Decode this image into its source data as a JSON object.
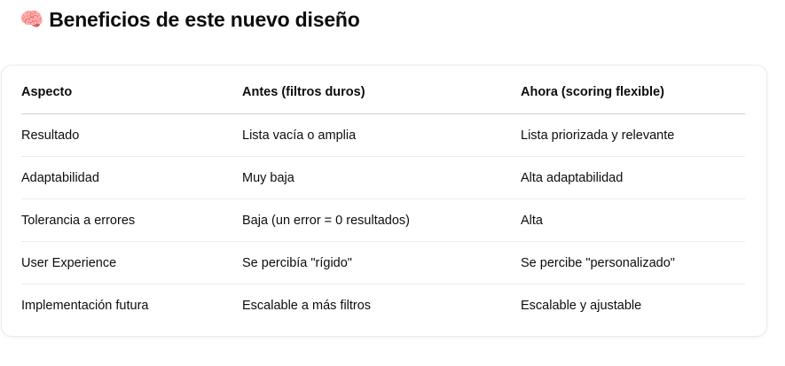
{
  "heading": {
    "emoji": "🧠",
    "title": "Beneficios de este nuevo diseño"
  },
  "table": {
    "headers": [
      "Aspecto",
      "Antes (filtros duros)",
      "Ahora (scoring flexible)"
    ],
    "rows": [
      [
        "Resultado",
        "Lista vacía o amplia",
        "Lista priorizada y relevante"
      ],
      [
        "Adaptabilidad",
        "Muy baja",
        "Alta adaptabilidad"
      ],
      [
        "Tolerancia a errores",
        "Baja (un error = 0 resultados)",
        "Alta"
      ],
      [
        "User Experience",
        "Se percibía \"rígido\"",
        "Se percibe \"personalizado\""
      ],
      [
        "Implementación futura",
        "Escalable a más filtros",
        "Escalable y ajustable"
      ]
    ]
  }
}
